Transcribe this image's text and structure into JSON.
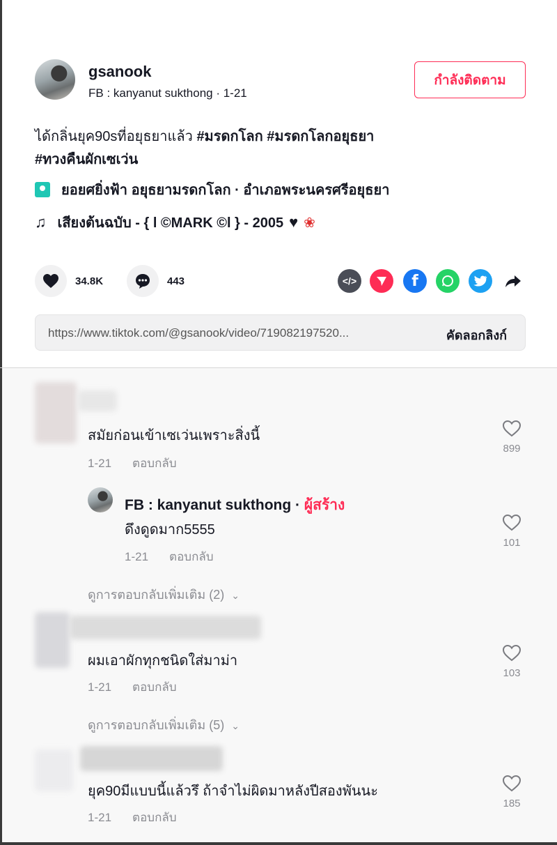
{
  "post": {
    "username": "gsanook",
    "subline": "FB : kanyanut sukthong · 1-21",
    "follow_label": "กำลังติดตาม",
    "caption_text": "ได้กลิ่นยุค90sที่อยุธยาแล้ว ",
    "tags": [
      "#มรดกโลก",
      "#มรดกโลกอยุธยา",
      "#ทวงคืนผักเซเว่น"
    ],
    "location": "ยอยศยิ่งฟ้า อยุธยามรดกโลก · อำเภอพระนครศรีอยุธยา",
    "music": "เสียงต้นฉบับ - { l ©MARK ©l } - 2005"
  },
  "actions": {
    "likes": "34.8K",
    "comments": "443"
  },
  "link": {
    "url": "https://www.tiktok.com/@gsanook/video/719082197520...",
    "copy_label": "คัดลอกลิงก์"
  },
  "comments": [
    {
      "text": "สมัยก่อนเข้าเซเว่นเพราะสิ่งนี้",
      "date": "1-21",
      "reply_label": "ตอบกลับ",
      "likes": "899",
      "reply": {
        "author": "FB : kanyanut sukthong",
        "dot": " · ",
        "badge": "ผู้สร้าง",
        "text": "ดึงดูดมาก5555",
        "date": "1-21",
        "reply_label": "ตอบกลับ",
        "likes": "101"
      },
      "more": "ดูการตอบกลับเพิ่มเติม (2)"
    },
    {
      "text": "ผมเอาผักทุกชนิดใส่มาม่า",
      "date": "1-21",
      "reply_label": "ตอบกลับ",
      "likes": "103",
      "more": "ดูการตอบกลับเพิ่มเติม (5)"
    },
    {
      "text": "ยุค90มีแบบนี้แล้วรึ ถ้าจำไม่ผิดมาหลังปีสองพันนะ",
      "date": "1-21",
      "reply_label": "ตอบกลับ",
      "likes": "185"
    }
  ],
  "icons": {
    "chevron": "⌄",
    "note": "♫",
    "heart_emoji": "♥",
    "flower_emoji": "❀"
  }
}
